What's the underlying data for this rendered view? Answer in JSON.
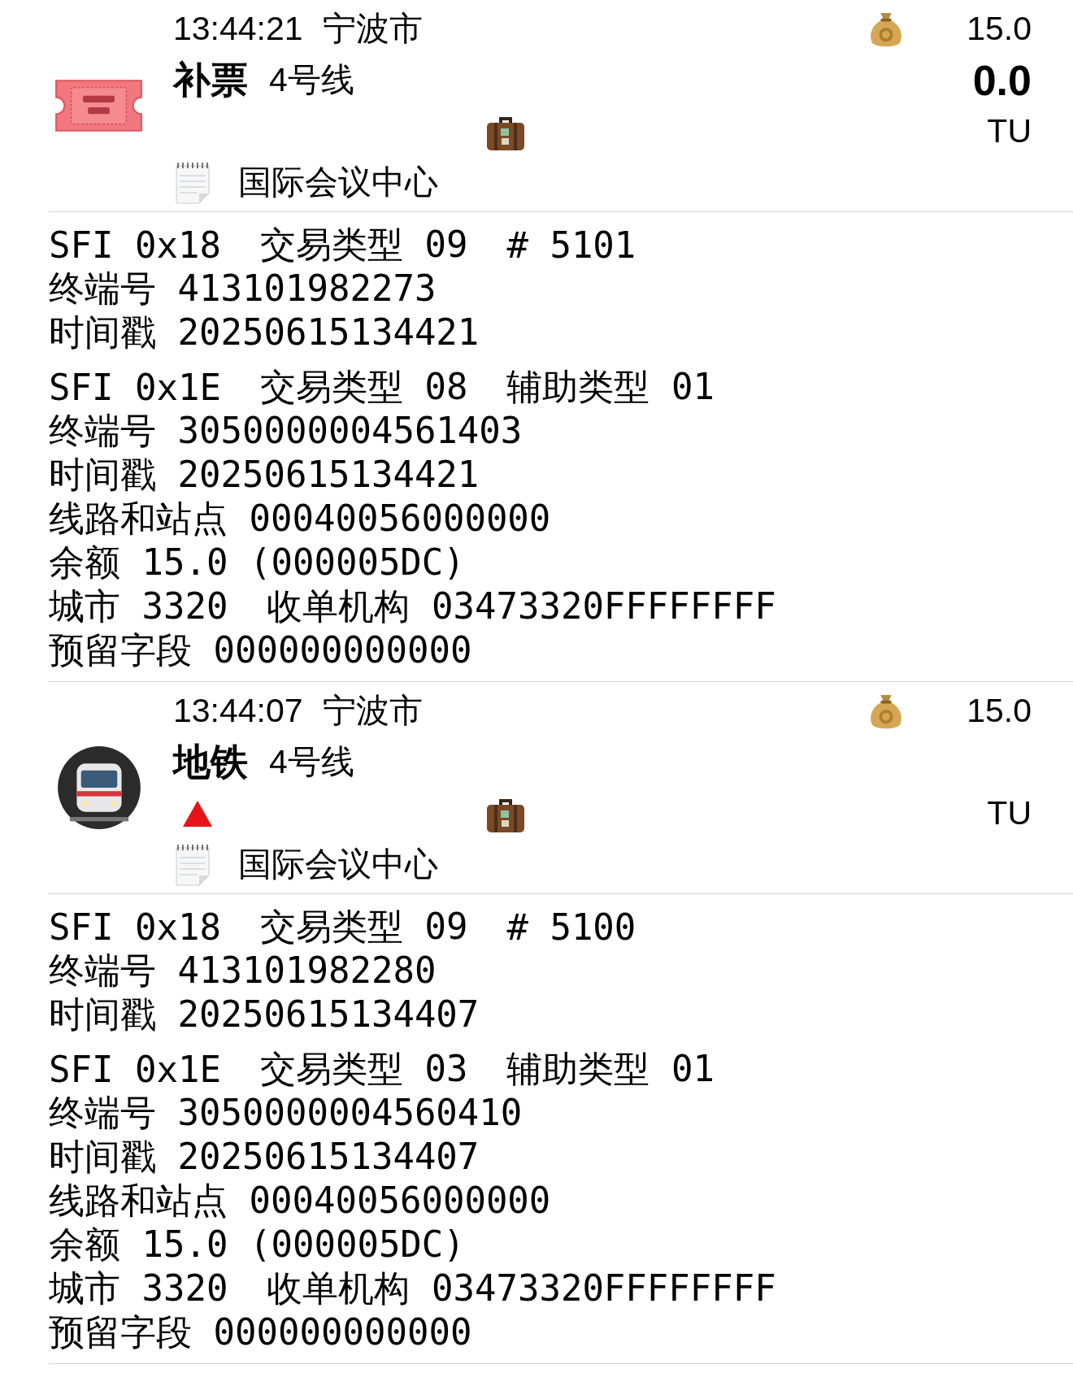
{
  "entries": [
    {
      "kind": "ticket",
      "time": "13:44:21",
      "city": "宁波市",
      "type_label": "补票",
      "line": "4号线",
      "alert": false,
      "station": "国际会议中心",
      "amount": "15.0",
      "change": "0.0",
      "unit": "TU",
      "records": [
        [
          [
            "SFI 0x18",
            "交易类型 09",
            "# 5101"
          ],
          [
            "终端号 413101982273"
          ],
          [
            "时间戳 20250615134421"
          ]
        ],
        [
          [
            "SFI 0x1E",
            "交易类型 08",
            "辅助类型 01"
          ],
          [
            "终端号 3050000004561403"
          ],
          [
            "时间戳 20250615134421"
          ],
          [
            "线路和站点 00040056000000"
          ],
          [
            "余额 15.0 (000005DC)"
          ],
          [
            "城市 3320",
            "收单机构 03473320FFFFFFFF"
          ],
          [
            "预留字段 000000000000"
          ]
        ]
      ]
    },
    {
      "kind": "metro",
      "time": "13:44:07",
      "city": "宁波市",
      "type_label": "地铁",
      "line": "4号线",
      "alert": true,
      "station": "国际会议中心",
      "amount": "15.0",
      "unit": "TU",
      "records": [
        [
          [
            "SFI 0x18",
            "交易类型 09",
            "# 5100"
          ],
          [
            "终端号 413101982280"
          ],
          [
            "时间戳 20250615134407"
          ]
        ],
        [
          [
            "SFI 0x1E",
            "交易类型 03",
            "辅助类型 01"
          ],
          [
            "终端号 3050000004560410"
          ],
          [
            "时间戳 20250615134407"
          ],
          [
            "线路和站点 00040056000000"
          ],
          [
            "余额 15.0 (000005DC)"
          ],
          [
            "城市 3320",
            "收单机构 03473320FFFFFFFF"
          ],
          [
            "预留字段 000000000000"
          ]
        ]
      ]
    }
  ]
}
